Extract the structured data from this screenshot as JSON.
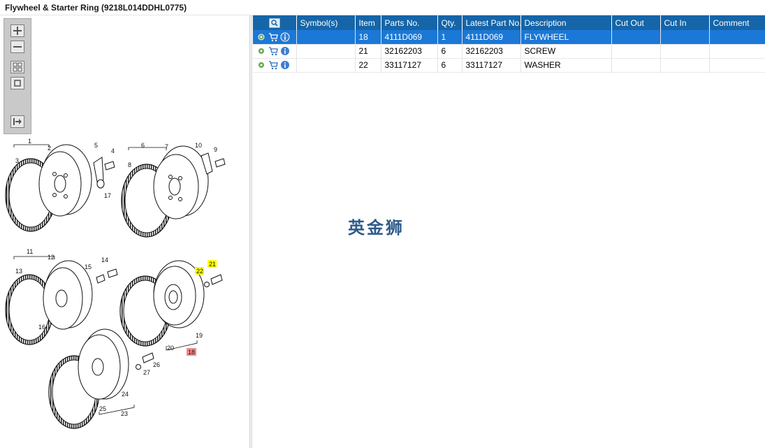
{
  "window": {
    "title": "Flywheel & Starter Ring (9218L014DDHL0775)"
  },
  "toolbar": {
    "buttons": [
      {
        "name": "zoom-in",
        "icon": "zoom-in-icon"
      },
      {
        "name": "zoom-out",
        "icon": "zoom-out-icon"
      },
      {
        "name": "fit-all",
        "icon": "fit-all-icon"
      },
      {
        "name": "actual-size",
        "icon": "actual-size-icon"
      },
      {
        "name": "export",
        "icon": "export-icon"
      }
    ]
  },
  "diagram": {
    "callouts": [
      "1",
      "2",
      "3",
      "4",
      "5",
      "17",
      "6",
      "7",
      "8",
      "10",
      "9",
      "11",
      "12",
      "13",
      "15",
      "14",
      "16",
      "22",
      "21",
      "19",
      "20",
      "18",
      "26",
      "27",
      "24",
      "25",
      "23"
    ]
  },
  "table": {
    "columns": [
      "Symbol(s)",
      "Item",
      "Parts No.",
      "Qty.",
      "Latest Part No.",
      "Description",
      "Cut Out",
      "Cut In",
      "Comment"
    ],
    "rows": [
      {
        "item": "18",
        "parts_no": "4111D069",
        "qty": "1",
        "latest": "4111D069",
        "description": "FLYWHEEL",
        "cut_out": "",
        "cut_in": "",
        "comment": ""
      },
      {
        "item": "21",
        "parts_no": "32162203",
        "qty": "6",
        "latest": "32162203",
        "description": "SCREW",
        "cut_out": "",
        "cut_in": "",
        "comment": ""
      },
      {
        "item": "22",
        "parts_no": "33117127",
        "qty": "6",
        "latest": "33117127",
        "description": "WASHER",
        "cut_out": "",
        "cut_in": "",
        "comment": ""
      }
    ],
    "selected_index": 0
  },
  "watermark": "英金狮",
  "colors": {
    "header": "#1565a8",
    "selected": "#1b78d6",
    "highlight_yellow": "#ffff00",
    "highlight_red": "#f28b8b"
  }
}
